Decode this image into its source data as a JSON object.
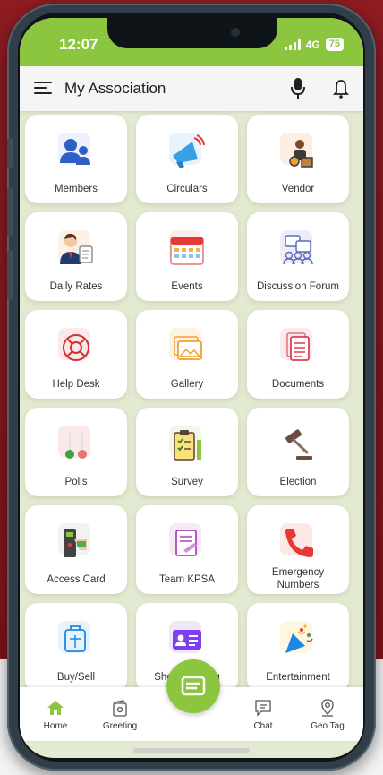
{
  "status": {
    "time": "12:07",
    "network": "4G",
    "battery": "75"
  },
  "app_bar": {
    "title": "My Association"
  },
  "tiles": [
    {
      "label": "Members",
      "icon": "members-icon"
    },
    {
      "label": "Circulars",
      "icon": "megaphone-icon"
    },
    {
      "label": "Vendor",
      "icon": "vendor-icon"
    },
    {
      "label": "Daily Rates",
      "icon": "daily-rates-icon"
    },
    {
      "label": "Events",
      "icon": "calendar-icon"
    },
    {
      "label": "Discussion Forum",
      "icon": "forum-icon"
    },
    {
      "label": "Help Desk",
      "icon": "help-desk-icon"
    },
    {
      "label": "Gallery",
      "icon": "gallery-icon"
    },
    {
      "label": "Documents",
      "icon": "documents-icon"
    },
    {
      "label": "Polls",
      "icon": "polls-icon"
    },
    {
      "label": "Survey",
      "icon": "survey-icon"
    },
    {
      "label": "Election",
      "icon": "gavel-icon"
    },
    {
      "label": "Access Card",
      "icon": "access-card-icon"
    },
    {
      "label": "Team KPSA",
      "icon": "team-icon"
    },
    {
      "label": "Emergency Numbers",
      "icon": "phone-icon"
    },
    {
      "label": "Buy/Sell",
      "icon": "buy-sell-icon"
    },
    {
      "label": "Show Booking",
      "icon": "id-card-icon"
    },
    {
      "label": "Entertainment",
      "icon": "party-icon"
    }
  ],
  "bottom_nav": {
    "home": "Home",
    "greeting": "Greeting",
    "chat": "Chat",
    "geo_tag": "Geo Tag"
  },
  "colors": {
    "accent": "#8cc63f",
    "grid_bg": "#e3ead2",
    "frame_bg": "#8e1b22"
  }
}
